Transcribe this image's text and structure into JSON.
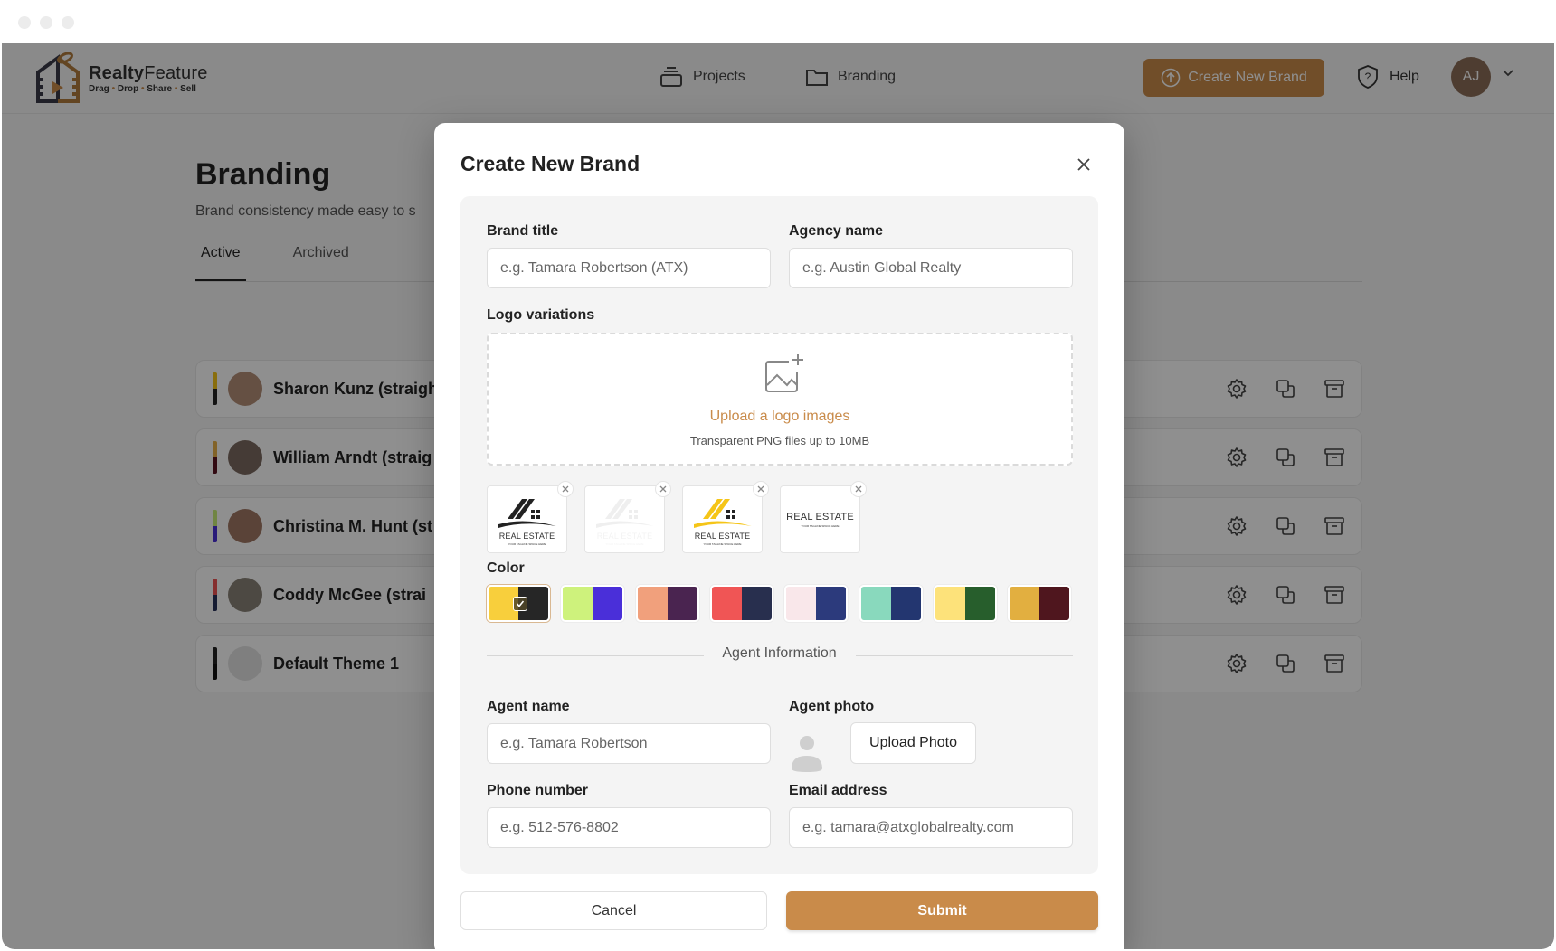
{
  "window": {
    "traffic_lights": [
      "close",
      "minimize",
      "zoom"
    ]
  },
  "app": {
    "logo": {
      "name_bold": "Realty",
      "name_light": "Feature",
      "tagline": [
        "Drag",
        "Drop",
        "Share",
        "Sell"
      ],
      "icon": "film-house-play-icon"
    },
    "nav": [
      {
        "label": "Projects",
        "icon": "stack-icon"
      },
      {
        "label": "Branding",
        "icon": "folder-icon"
      }
    ],
    "create_button": {
      "label": "Create New Brand",
      "icon": "upload-circle-icon"
    },
    "help": {
      "label": "Help",
      "icon": "shield-question-icon"
    },
    "user": {
      "initials": "AJ",
      "menu_icon": "chevron-down-icon"
    },
    "colors": {
      "accent": "#c98b4a",
      "avatar": "#8b6d58"
    }
  },
  "page": {
    "title": "Branding",
    "subtitle": "Brand consistency made easy to s",
    "tabs": [
      {
        "label": "Active",
        "active": true
      },
      {
        "label": "Archived",
        "active": false
      }
    ],
    "brands": [
      {
        "name": "Sharon Kunz (straigh",
        "colors": [
          "#f5c518",
          "#222222"
        ],
        "avatar": "photo"
      },
      {
        "name": "William Arndt (straig",
        "colors": [
          "#e8b04a",
          "#5a1220"
        ],
        "avatar": "photo"
      },
      {
        "name": "Christina M. Hunt (st",
        "colors": [
          "#c8ee78",
          "#4a2fd8"
        ],
        "avatar": "photo"
      },
      {
        "name": "Coddy McGee (strai",
        "colors": [
          "#ee5252",
          "#26305a"
        ],
        "avatar": "photo"
      },
      {
        "name": "Default Theme 1",
        "colors": [
          "#222222",
          "#111111"
        ],
        "avatar": "placeholder"
      }
    ],
    "row_actions": [
      "gear-icon",
      "duplicate-icon",
      "archive-icon"
    ]
  },
  "modal": {
    "title": "Create New Brand",
    "brand_title": {
      "label": "Brand title",
      "placeholder": "e.g. Tamara Robertson (ATX)",
      "value": ""
    },
    "agency_name": {
      "label": "Agency name",
      "placeholder": "e.g. Austin Global Realty",
      "value": ""
    },
    "logo_variations": {
      "label": "Logo variations",
      "upload_link": "Upload a logo images",
      "upload_hint": "Transparent PNG files up to 10MB",
      "thumbnails": [
        {
          "variant": "dark",
          "text": "REAL ESTATE",
          "sub": "YOUR TAGLINE SPACE HERE"
        },
        {
          "variant": "white",
          "text": "REAL ESTATE",
          "sub": "YOUR TAGLINE SPACE HERE"
        },
        {
          "variant": "yellow",
          "text": "REAL ESTATE",
          "sub": "YOUR TAGLINE SPACE HERE"
        },
        {
          "variant": "text-only",
          "text": "REAL ESTATE",
          "sub": "YOUR TAGLINE SPACE HERE"
        }
      ]
    },
    "color": {
      "label": "Color",
      "selected_index": 0,
      "palettes": [
        [
          "#f8cf3c",
          "#262626"
        ],
        [
          "#cef27c",
          "#4a2fd9"
        ],
        [
          "#f1a07c",
          "#4a2450"
        ],
        [
          "#f05555",
          "#282f4e"
        ],
        [
          "#f9e7ea",
          "#2c3a7c"
        ],
        [
          "#89d9bd",
          "#233670"
        ],
        [
          "#fde27a",
          "#275e2c"
        ],
        [
          "#e2af40",
          "#4f161e"
        ]
      ]
    },
    "agent_section_title": "Agent Information",
    "agent_name": {
      "label": "Agent name",
      "placeholder": "e.g. Tamara Robertson",
      "value": ""
    },
    "agent_photo": {
      "label": "Agent photo",
      "button": "Upload Photo"
    },
    "phone": {
      "label": "Phone number",
      "placeholder": "e.g. 512-576-8802",
      "value": ""
    },
    "email": {
      "label": "Email address",
      "placeholder": "e.g. tamara@atxglobalrealty.com",
      "value": ""
    },
    "cancel_label": "Cancel",
    "submit_label": "Submit"
  }
}
